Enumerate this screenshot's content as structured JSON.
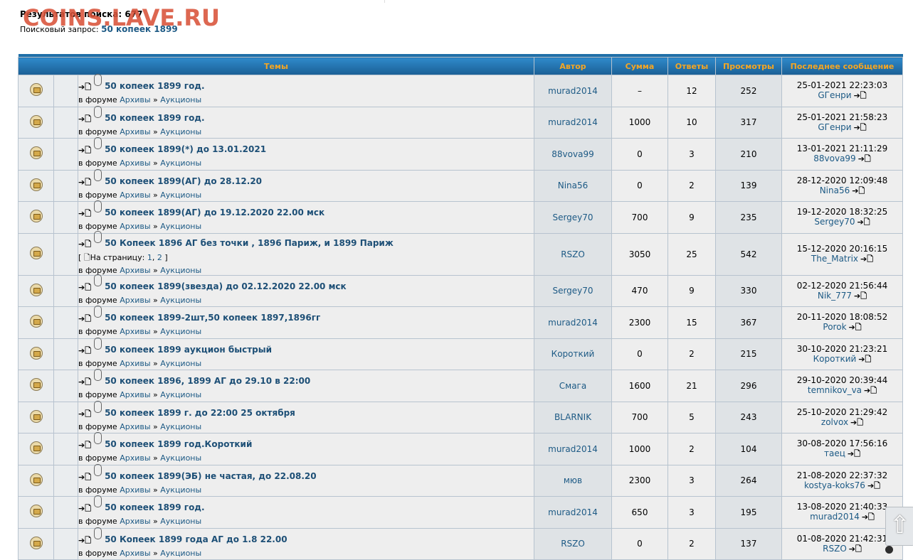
{
  "watermark": "COINS.LAVE.RU",
  "search": {
    "count_label": "Результатов поиска: 677",
    "query_label": "Поисковый запрос:",
    "query_value": "50 копеек 1899"
  },
  "headers": {
    "topics": "Темы",
    "author": "Автор",
    "sum": "Сумма",
    "replies": "Ответы",
    "views": "Просмотры",
    "last": "Последнее сообщение"
  },
  "forum_prefix": "в форуме",
  "forum_sep": "»",
  "pages_label": "На страницу:",
  "rows": [
    {
      "title": "50 копеек 1899 год.",
      "forum": "Архивы",
      "sub": "Аукционы",
      "author": "murad2014",
      "sum": "–",
      "replies": "12",
      "views": "252",
      "last_date": "25-01-2021 22:23:03",
      "last_user": "GГенри"
    },
    {
      "title": "50 копеек 1899 год.",
      "forum": "Архивы",
      "sub": "Аукционы",
      "author": "murad2014",
      "sum": "1000",
      "replies": "10",
      "views": "317",
      "last_date": "25-01-2021 21:58:23",
      "last_user": "GГенри"
    },
    {
      "title": "50 копеек 1899(*) до 13.01.2021",
      "forum": "Архивы",
      "sub": "Аукционы",
      "author": "88vova99",
      "sum": "0",
      "replies": "3",
      "views": "210",
      "last_date": "13-01-2021 21:11:29",
      "last_user": "88vova99"
    },
    {
      "title": "50 копеек 1899(АГ) до 28.12.20",
      "forum": "Архивы",
      "sub": "Аукционы",
      "author": "Nina56",
      "sum": "0",
      "replies": "2",
      "views": "139",
      "last_date": "28-12-2020 12:09:48",
      "last_user": "Nina56"
    },
    {
      "title": "50 копеек 1899(АГ) до 19.12.2020 22.00 мск",
      "forum": "Архивы",
      "sub": "Аукционы",
      "author": "Sergey70",
      "sum": "700",
      "replies": "9",
      "views": "235",
      "last_date": "19-12-2020 18:32:25",
      "last_user": "Sergey70"
    },
    {
      "title": "50 Копеек 1896 АГ без точки , 1896 Париж, и 1899 Париж",
      "pages": [
        "1",
        "2"
      ],
      "forum": "Архивы",
      "sub": "Аукционы",
      "author": "RSZO",
      "sum": "3050",
      "replies": "25",
      "views": "542",
      "last_date": "15-12-2020 20:16:15",
      "last_user": "The_Matrix"
    },
    {
      "title": "50 копеек 1899(звезда) до 02.12.2020 22.00 мск",
      "forum": "Архивы",
      "sub": "Аукционы",
      "author": "Sergey70",
      "sum": "470",
      "replies": "9",
      "views": "330",
      "last_date": "02-12-2020 21:56:44",
      "last_user": "Nik_777"
    },
    {
      "title": "50 копеек 1899-2шт,50 копеек 1897,1896гг",
      "forum": "Архивы",
      "sub": "Аукционы",
      "author": "murad2014",
      "sum": "2300",
      "replies": "15",
      "views": "367",
      "last_date": "20-11-2020 18:08:52",
      "last_user": "Porok"
    },
    {
      "title": "50 копеек 1899 аукцион быстрый",
      "forum": "Архивы",
      "sub": "Аукционы",
      "author": "Короткий",
      "sum": "0",
      "replies": "2",
      "views": "215",
      "last_date": "30-10-2020 21:23:21",
      "last_user": "Короткий"
    },
    {
      "title": "50 копеек 1896, 1899 АГ до 29.10 в 22:00",
      "forum": "Архивы",
      "sub": "Аукционы",
      "author": "Смага",
      "sum": "1600",
      "replies": "21",
      "views": "296",
      "last_date": "29-10-2020 20:39:44",
      "last_user": "temnikov_va"
    },
    {
      "title": "50 копеек 1899 г. до 22:00 25 октября",
      "forum": "Архивы",
      "sub": "Аукционы",
      "author": "BLARNIK",
      "sum": "700",
      "replies": "5",
      "views": "243",
      "last_date": "25-10-2020 21:29:42",
      "last_user": "zolvox"
    },
    {
      "title": "50 копеек 1899 год.Короткий",
      "forum": "Архивы",
      "sub": "Аукционы",
      "author": "murad2014",
      "sum": "1000",
      "replies": "2",
      "views": "104",
      "last_date": "30-08-2020 17:56:16",
      "last_user": "таец"
    },
    {
      "title": "50 копеек 1899(ЭБ) не частая, до 22.08.20",
      "forum": "Архивы",
      "sub": "Аукционы",
      "author": "мюв",
      "sum": "2300",
      "replies": "3",
      "views": "264",
      "last_date": "21-08-2020 22:37:32",
      "last_user": "kostya-koks76"
    },
    {
      "title": "50 копеек 1899 год.",
      "forum": "Архивы",
      "sub": "Аукционы",
      "author": "murad2014",
      "sum": "650",
      "replies": "3",
      "views": "195",
      "last_date": "13-08-2020 21:40:33",
      "last_user": "murad2014"
    },
    {
      "title": "50 Копеек 1899 года АГ до 1.8 22.00",
      "forum": "Архивы",
      "sub": "Аукционы",
      "author": "RSZO",
      "sum": "0",
      "replies": "2",
      "views": "137",
      "last_date": "01-08-2020 21:42:31",
      "last_user": "RSZO"
    }
  ]
}
